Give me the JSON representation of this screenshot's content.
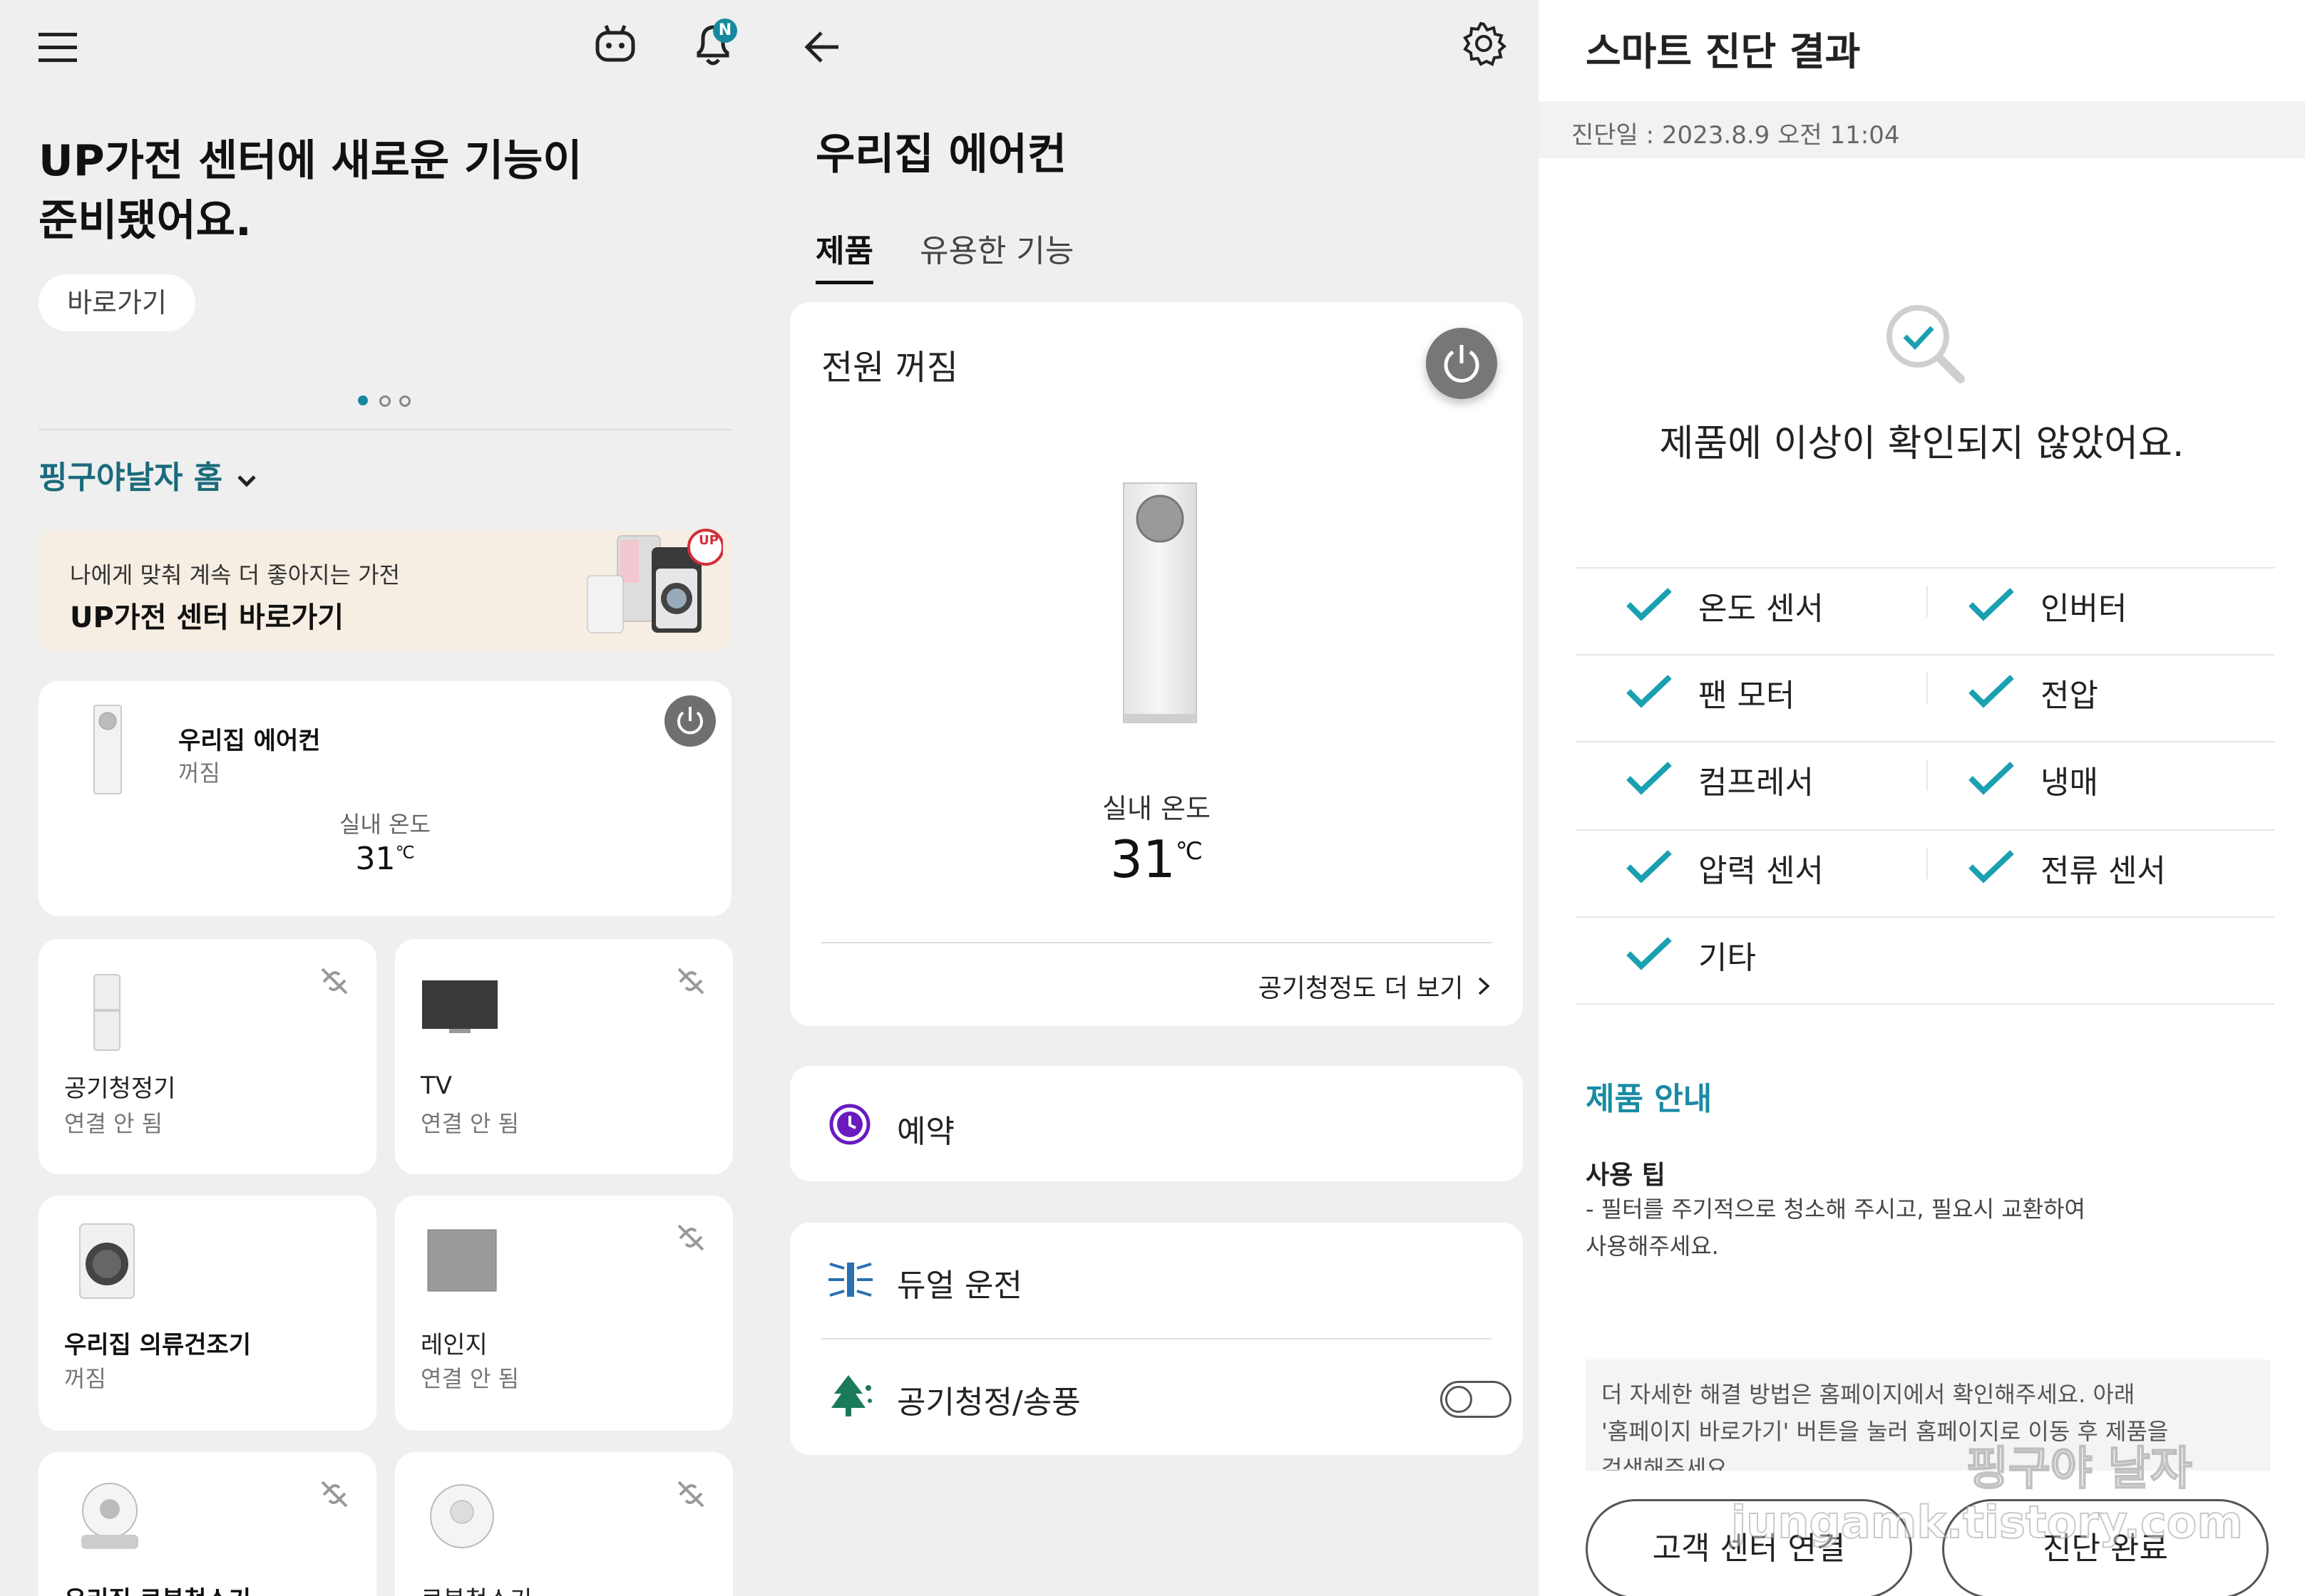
{
  "home": {
    "banner": {
      "title_line1": "UP가전 센터에 새로운 기능이",
      "title_line2": "준비됐어요.",
      "shortcut_label": "바로가기"
    },
    "home_selector": "핑구야날자 홈",
    "promo": {
      "subtitle": "나에게 맞춰 계속 더 좋아지는 가전",
      "title": "UP가전 센터 바로가기",
      "badge": "UP"
    },
    "main_device": {
      "name": "우리집 에어컨",
      "status": "꺼짐",
      "temp_label": "실내 온도",
      "temp_value": "31",
      "temp_unit": "℃"
    },
    "devices": [
      {
        "name": "공기청정기",
        "status": "연결 안 됨"
      },
      {
        "name": "TV",
        "status": "연결 안 됨"
      },
      {
        "name": "우리집 의류건조기",
        "status": "꺼짐"
      },
      {
        "name": "레인지",
        "status": "연결 안 됨"
      },
      {
        "name": "우리집 로봇청소기",
        "status": ""
      },
      {
        "name": "로봇청소기",
        "status": ""
      }
    ],
    "notification_badge": "N"
  },
  "detail": {
    "title": "우리집 에어컨",
    "tabs": [
      {
        "label": "제품",
        "active": true
      },
      {
        "label": "유용한 기능",
        "active": false
      }
    ],
    "power_status": "전원 꺼짐",
    "temp_label": "실내 온도",
    "temp_value": "31",
    "temp_unit": "℃",
    "air_quality_link": "공기청정도 더 보기",
    "schedule_label": "예약",
    "dual_label": "듀얼 운전",
    "purify_label": "공기청정/송풍",
    "purify_toggle_on": false
  },
  "diagnosis": {
    "title": "스마트 진단 결과",
    "date": "진단일 : 2023.8.9 오전 11:04",
    "result": "제품에 이상이 확인되지 않았어요.",
    "items": [
      "온도 센서",
      "인버터",
      "팬 모터",
      "전압",
      "컴프레서",
      "냉매",
      "압력 센서",
      "전류 센서",
      "기타"
    ],
    "guide_header": "제품 안내",
    "tip_title": "사용 팁",
    "tip_line1": "- 필터를 주기적으로 청소해 주시고, 필요시 교환하여",
    "tip_line2": "사용해주세요.",
    "notice_line1": "더 자세한 해결 방법은 홈페이지에서 확인해주세요. 아래",
    "notice_line2": "'홈페이지 바로가기' 버튼을 눌러 홈페이지로 이동 후 제품을",
    "notice_line3": "검색해주세요.",
    "btn_support": "고객 센터 연결",
    "btn_done": "진단 완료",
    "watermark_line1": "핑구야 날자",
    "watermark_line2": "jungamk.tistory.com"
  },
  "colors": {
    "accent_teal": "#1a8aa5",
    "check_teal": "#1aa0b0",
    "purple": "#6a1bbf",
    "green": "#1a7a5a",
    "blue_icon": "#2a6fb0"
  }
}
